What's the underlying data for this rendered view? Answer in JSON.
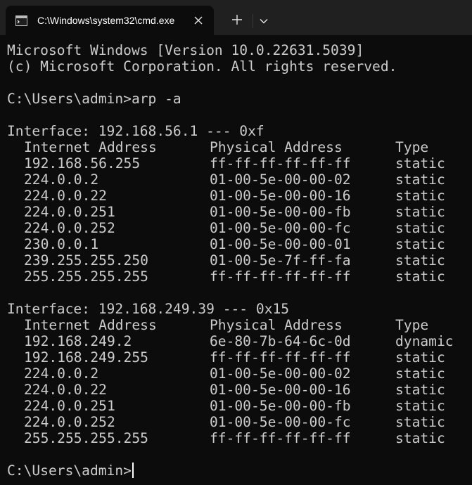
{
  "tab": {
    "title": "C:\\Windows\\system32\\cmd.exe",
    "icon": "cmd-icon"
  },
  "buttons": {
    "close_icon": "close-icon",
    "new_tab_icon": "plus-icon",
    "dropdown_icon": "chevron-down-icon"
  },
  "colors": {
    "background": "#0c0c0c",
    "tabbar": "#202020",
    "text": "#cccccc"
  },
  "terminal": {
    "banner1": "Microsoft Windows [Version 10.0.22631.5039]",
    "banner2": "(c) Microsoft Corporation. All rights reserved.",
    "command": "C:\\Users\\admin>arp -a",
    "prompt": "C:\\Users\\admin>",
    "headers": {
      "ip": "Internet Address",
      "mac": "Physical Address",
      "type": "Type"
    },
    "interfaces": [
      {
        "title": "Interface: 192.168.56.1 --- 0xf",
        "entries": [
          {
            "ip": "192.168.56.255",
            "mac": "ff-ff-ff-ff-ff-ff",
            "type": "static"
          },
          {
            "ip": "224.0.0.2",
            "mac": "01-00-5e-00-00-02",
            "type": "static"
          },
          {
            "ip": "224.0.0.22",
            "mac": "01-00-5e-00-00-16",
            "type": "static"
          },
          {
            "ip": "224.0.0.251",
            "mac": "01-00-5e-00-00-fb",
            "type": "static"
          },
          {
            "ip": "224.0.0.252",
            "mac": "01-00-5e-00-00-fc",
            "type": "static"
          },
          {
            "ip": "230.0.0.1",
            "mac": "01-00-5e-00-00-01",
            "type": "static"
          },
          {
            "ip": "239.255.255.250",
            "mac": "01-00-5e-7f-ff-fa",
            "type": "static"
          },
          {
            "ip": "255.255.255.255",
            "mac": "ff-ff-ff-ff-ff-ff",
            "type": "static"
          }
        ]
      },
      {
        "title": "Interface: 192.168.249.39 --- 0x15",
        "entries": [
          {
            "ip": "192.168.249.2",
            "mac": "6e-80-7b-64-6c-0d",
            "type": "dynamic"
          },
          {
            "ip": "192.168.249.255",
            "mac": "ff-ff-ff-ff-ff-ff",
            "type": "static"
          },
          {
            "ip": "224.0.0.2",
            "mac": "01-00-5e-00-00-02",
            "type": "static"
          },
          {
            "ip": "224.0.0.22",
            "mac": "01-00-5e-00-00-16",
            "type": "static"
          },
          {
            "ip": "224.0.0.251",
            "mac": "01-00-5e-00-00-fb",
            "type": "static"
          },
          {
            "ip": "224.0.0.252",
            "mac": "01-00-5e-00-00-fc",
            "type": "static"
          },
          {
            "ip": "255.255.255.255",
            "mac": "ff-ff-ff-ff-ff-ff",
            "type": "static"
          }
        ]
      }
    ]
  }
}
